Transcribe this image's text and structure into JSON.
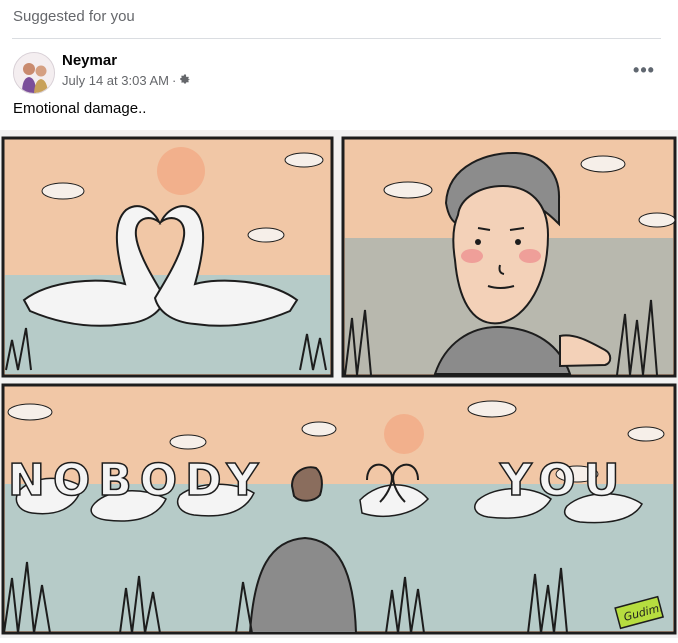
{
  "feed": {
    "suggested_label": "Suggested for you"
  },
  "post": {
    "author": "Neymar",
    "timestamp": "July 14 at 3:03 AM",
    "separator": "·",
    "privacy_icon": "gear-icon",
    "more_icon": "more-options-icon",
    "caption": "Emotional damage.."
  },
  "comic": {
    "bottom_text": "NOBODY",
    "bottom_text_right": "YOU",
    "signature": "Gudim."
  },
  "colors": {
    "sky": "#f1c7a6",
    "water": "#b6cbc8",
    "ink": "#1d1d1d",
    "swan": "#f4f4f4",
    "sun": "#f2b08c"
  }
}
